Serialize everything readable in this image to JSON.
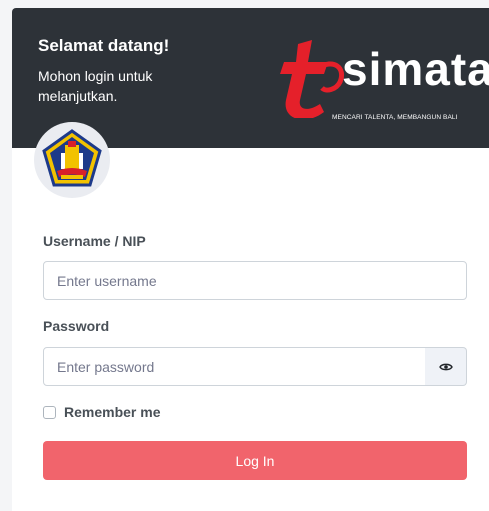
{
  "header": {
    "welcome": "Selamat datang!",
    "subtitle": "Mohon login untuk melanjutkan."
  },
  "brand": {
    "wordmark": "simata",
    "letter": "t",
    "tagline": "MENCARI TALENTA, MEMBANGUN BALI"
  },
  "avatar": {
    "icon": "provincial-emblem-icon"
  },
  "form": {
    "username_label": "Username / NIP",
    "username_placeholder": "Enter username",
    "username_value": "",
    "password_label": "Password",
    "password_placeholder": "Enter password",
    "password_value": "",
    "show_password_icon": "eye-icon",
    "remember_label": "Remember me",
    "remember_checked": false,
    "login_label": "Log In"
  },
  "colors": {
    "header_bg": "#2d3238",
    "brand_red": "#e5202a",
    "button_bg": "#f1646c"
  }
}
